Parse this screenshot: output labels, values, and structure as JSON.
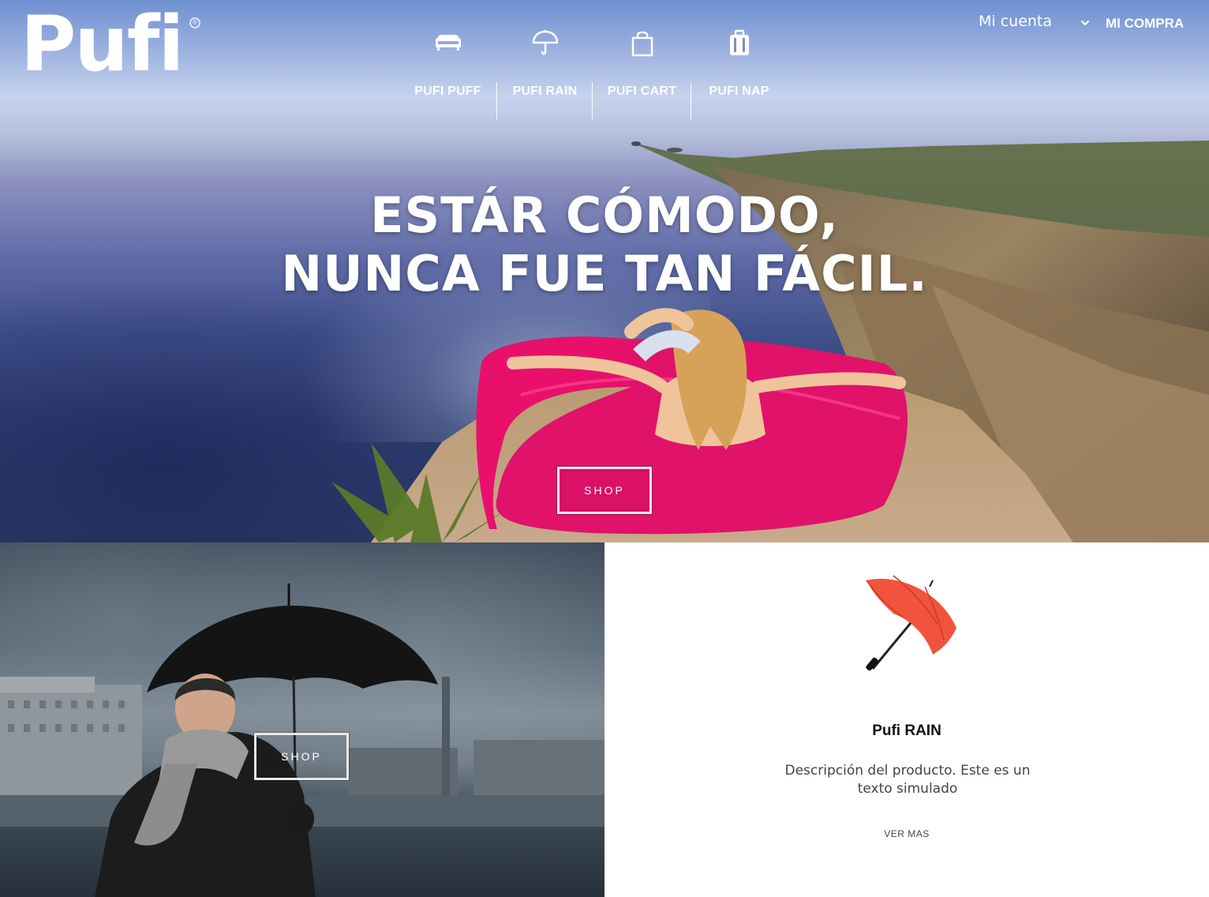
{
  "header": {
    "logo_text": "Pufi",
    "logo_mark": "®",
    "account_label": "Mi cuenta",
    "account_icon": "chevron-down-icon",
    "cart_label": "MI COMPRA"
  },
  "nav": {
    "items": [
      {
        "label": "PUFI PUFF",
        "icon": "sofa-icon"
      },
      {
        "label": "PUFI RAIN",
        "icon": "umbrella-icon"
      },
      {
        "label": "PUFI CART",
        "icon": "shopping-bag-icon"
      },
      {
        "label": "PUFI NAP",
        "icon": "luggage-icon"
      }
    ]
  },
  "hero": {
    "headline_line1": "ESTÁR CÓMODO,",
    "headline_line2": "NUNCA FUE TAN FÁCIL.",
    "cta_label": "SHOP"
  },
  "promo": {
    "cta_label": "SHOP"
  },
  "product": {
    "name": "Pufi RAIN",
    "description": "Descripción del producto. Este es un texto simulado",
    "link_label": "VER MAS",
    "umbrella_color": "#f2533c"
  },
  "colors": {
    "hero_sofa": "#e8106b",
    "accent_text": "#ffffff"
  }
}
